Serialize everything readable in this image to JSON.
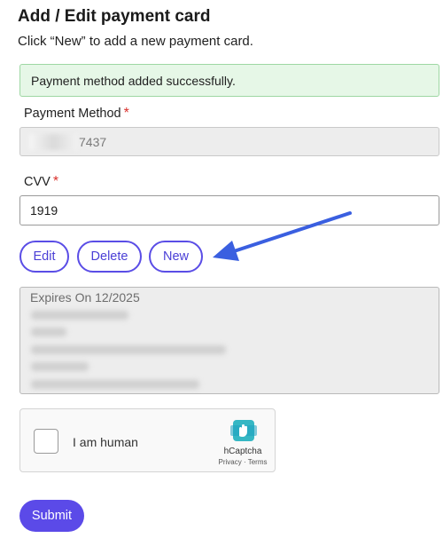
{
  "page": {
    "title": "Add / Edit payment card",
    "subtitle": "Click “New” to add a new payment card."
  },
  "alert": {
    "message": "Payment method added successfully."
  },
  "payment_method": {
    "label": "Payment Method",
    "required_mark": "*",
    "value_suffix": "7437"
  },
  "cvv": {
    "label": "CVV",
    "required_mark": "*",
    "value": "1919"
  },
  "buttons": {
    "edit": "Edit",
    "delete": "Delete",
    "new": "New",
    "submit": "Submit"
  },
  "card_details": {
    "expires": "Expires On 12/2025"
  },
  "captcha": {
    "label": "I am human",
    "brand": "hCaptcha",
    "links": "Privacy · Terms"
  },
  "colors": {
    "accent": "#5b4ae8",
    "success_bg": "#e6f7e7",
    "success_border": "#9ed7a3",
    "required": "#d9302c",
    "annotation_arrow": "#3a5fe0"
  }
}
